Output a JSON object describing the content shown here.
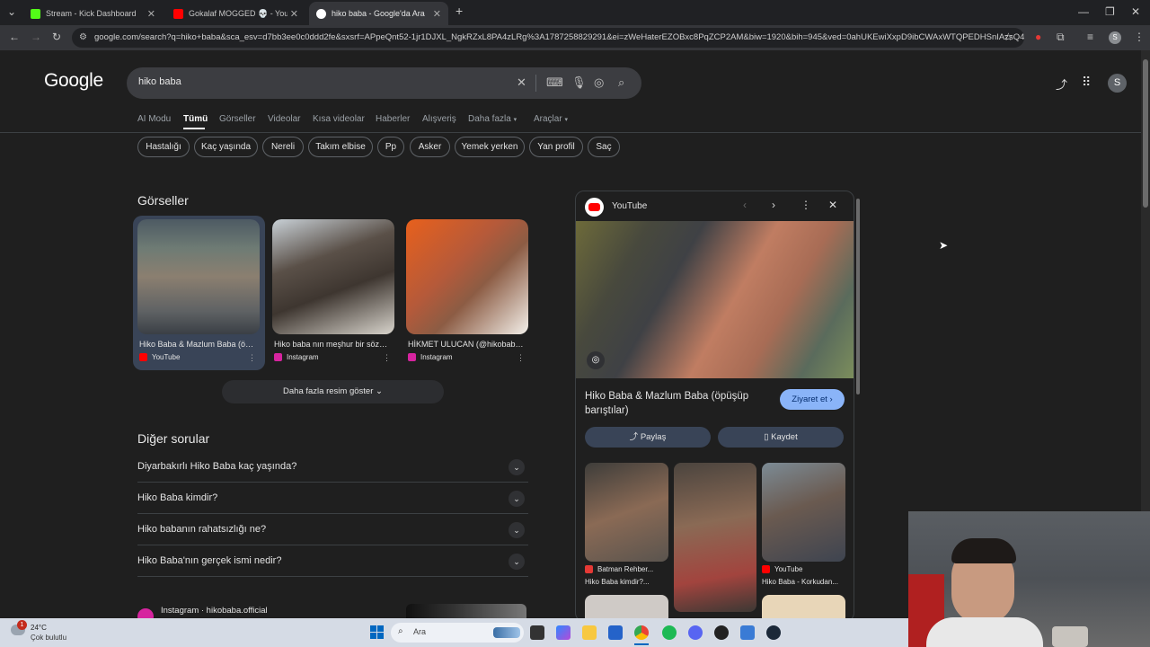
{
  "browser": {
    "tabs": [
      {
        "title": "Stream - Kick Dashboard",
        "favicon_color": "#53fc18"
      },
      {
        "title": "Gokalaf MOGGED 💀 - YouTube",
        "favicon_color": "#ff0000"
      },
      {
        "title": "hiko baba - Google'da Ara",
        "favicon_color": "#4285f4"
      }
    ],
    "new_tab": "+",
    "url": "google.com/search?q=hiko+baba&sca_esv=d7bb3ee0c0ddd2fe&sxsrf=APpeQnt52-1jr1DJXL_NgkRZxL8PA4zLRg%3A1787258829291&ei=zWeHaterEZOBxc8PqZCP2AM&biw=1920&bih=945&ved=0ahUKEwiXxpD9ibCWAxWTQPEDHSnIAzsQ4...",
    "profile_initial": "S"
  },
  "google": {
    "logo": "Google",
    "query": "hiko baba",
    "nav_tabs": [
      "AI Modu",
      "Tümü",
      "Görseller",
      "Videolar",
      "Kısa videolar",
      "Haberler",
      "Alışveriş",
      "Daha fazla",
      "Araçlar"
    ],
    "chips": [
      "Hastalığı",
      "Kaç yaşında",
      "Nereli",
      "Takım elbise",
      "Pp",
      "Asker",
      "Yemek yerken",
      "Yan profil",
      "Saç"
    ],
    "avatar_initial": "S"
  },
  "images_section": {
    "title": "Görseller",
    "cards": [
      {
        "caption": "Hiko Baba & Mazlum Baba (öpüşüp barıştılar)",
        "source": "YouTube",
        "source_color": "#ff0000"
      },
      {
        "caption": "Hiko baba nın meşhur bir sözü var",
        "source": "Instagram",
        "source_color": "#d6249f"
      },
      {
        "caption": "HİKMET ULUCAN (@hikobaba.official)",
        "source": "Instagram",
        "source_color": "#d6249f"
      }
    ],
    "more_button": "Daha fazla resim göster"
  },
  "questions_section": {
    "title": "Diğer sorular",
    "questions": [
      "Diyarbakırlı Hiko Baba kaç yaşında?",
      "Hiko Baba kimdir?",
      "Hiko babanın rahatsızlığı ne?",
      "Hiko Baba'nın gerçek ismi nedir?"
    ]
  },
  "result": {
    "source": "Instagram · hikobaba.official"
  },
  "panel": {
    "source": "YouTube",
    "title": "Hiko Baba & Mazlum Baba (öpüşüp barıştılar)",
    "visit_button": "Ziyaret et",
    "share_button": "Paylaş",
    "save_button": "Kaydet",
    "related": [
      {
        "source": "Batman Rehber...",
        "caption": "Hiko Baba kimdir?...",
        "source_color": "#e53935"
      },
      {
        "source": "",
        "caption": "",
        "source_color": "#000000"
      },
      {
        "source": "YouTube",
        "caption": "Hiko Baba - Korkudan...",
        "source_color": "#ff0000"
      }
    ]
  },
  "taskbar": {
    "weather_temp": "24°C",
    "weather_desc": "Çok bulutlu",
    "weather_badge": "1",
    "search_placeholder": "Ara"
  }
}
